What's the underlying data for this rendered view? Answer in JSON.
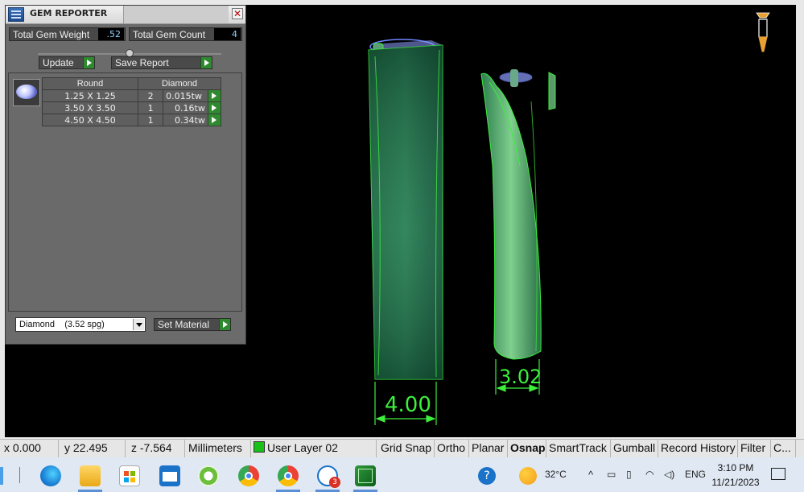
{
  "gem_reporter": {
    "title": "GEM REPORTER",
    "close_label": "✕",
    "total_weight_label": "Total Gem Weight",
    "total_weight_value": ".52",
    "total_count_label": "Total Gem Count",
    "total_count_value": "4",
    "update_label": "Update",
    "save_report_label": "Save Report",
    "table": {
      "headers": [
        "Round",
        "Diamond"
      ],
      "rows": [
        {
          "size": "1.25 X 1.25",
          "count": "2",
          "weight": "0.015tw"
        },
        {
          "size": "3.50 X 3.50",
          "count": "1",
          "weight": "0.16tw"
        },
        {
          "size": "4.50 X 4.50",
          "count": "1",
          "weight": "0.34tw"
        }
      ]
    },
    "material_value": "Diamond    (3.52 spg)",
    "set_material_label": "Set Material"
  },
  "viewport": {
    "dimension_left": "4.00",
    "dimension_right": "3.02",
    "model_color": "#1f6b45",
    "dimension_color": "#3cf03c"
  },
  "status_bar": {
    "x": "x 0.000",
    "y": "y 22.495",
    "z": "z -7.564",
    "units": "Millimeters",
    "layer": "User Layer 02",
    "grid_snap": "Grid Snap",
    "ortho": "Ortho",
    "planar": "Planar",
    "osnap": "Osnap",
    "smarttrack": "SmartTrack",
    "gumball": "Gumball",
    "record_history": "Record History",
    "filter": "Filter",
    "last": "C..."
  },
  "taskbar": {
    "temperature": "32°C",
    "language": "ENG",
    "time": "3:10 PM",
    "date": "11/21/2023",
    "badge_count": "3"
  }
}
